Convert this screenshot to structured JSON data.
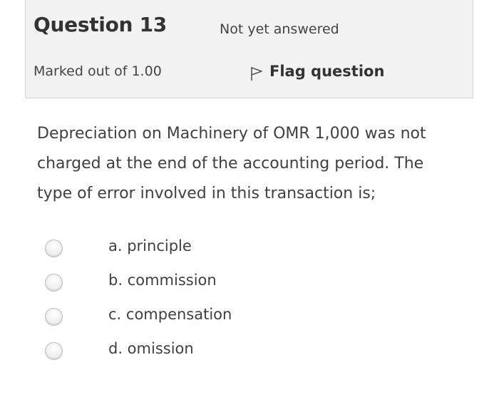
{
  "question": {
    "title": "Question 13",
    "state": "Not yet answered",
    "grade": "Marked out of 1.00",
    "flag_label": "Flag question",
    "flag_icon": "flag-icon",
    "text_lines": [
      "Depreciation on Machinery of OMR 1,000 was not",
      "charged at the end of the accounting period. The",
      "type of error involved in this transaction is;"
    ]
  },
  "answers": [
    {
      "label": "a. principle",
      "selected": false
    },
    {
      "label": "b. commission",
      "selected": false
    },
    {
      "label": "c. compensation",
      "selected": false
    },
    {
      "label": "d. omission",
      "selected": false
    }
  ]
}
